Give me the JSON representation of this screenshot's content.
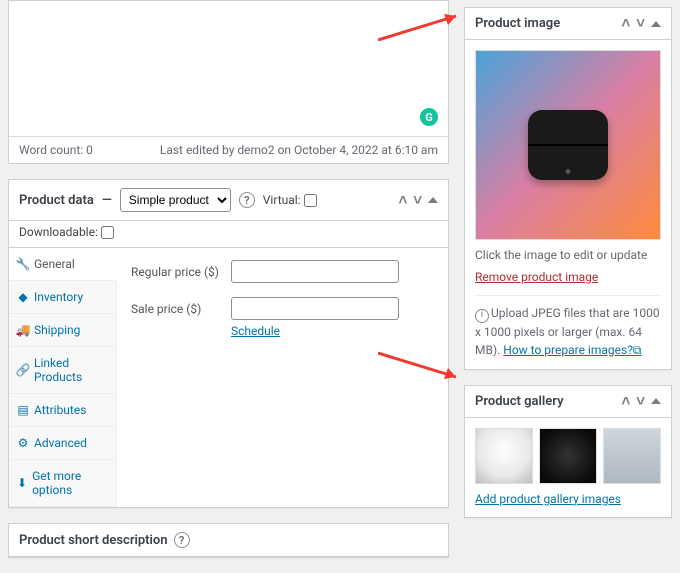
{
  "editor": {
    "word_count_label": "Word count: 0",
    "last_edited": "Last edited by demo2 on October 4, 2022 at 6:10 am"
  },
  "product_data": {
    "title": "Product data",
    "dash": "—",
    "type_option": "Simple product",
    "virtual_label": "Virtual:",
    "downloadable_label": "Downloadable:",
    "tabs": {
      "general": "General",
      "inventory": "Inventory",
      "shipping": "Shipping",
      "linked": "Linked Products",
      "attributes": "Attributes",
      "advanced": "Advanced",
      "getmore": "Get more options"
    },
    "fields": {
      "regular_price_label": "Regular price ($)",
      "sale_price_label": "Sale price ($)",
      "schedule": "Schedule"
    }
  },
  "short_desc": {
    "title": "Product short description"
  },
  "product_image": {
    "title": "Product image",
    "hint": "Click the image to edit or update",
    "remove": "Remove product image",
    "upload_prefix": "Upload JPEG files that are 1000 x 1000 pixels or larger (max. 64 MB). ",
    "how_to": "How to prepare images?",
    "ext_icon": "⧉"
  },
  "product_gallery": {
    "title": "Product gallery",
    "add": "Add product gallery images"
  }
}
